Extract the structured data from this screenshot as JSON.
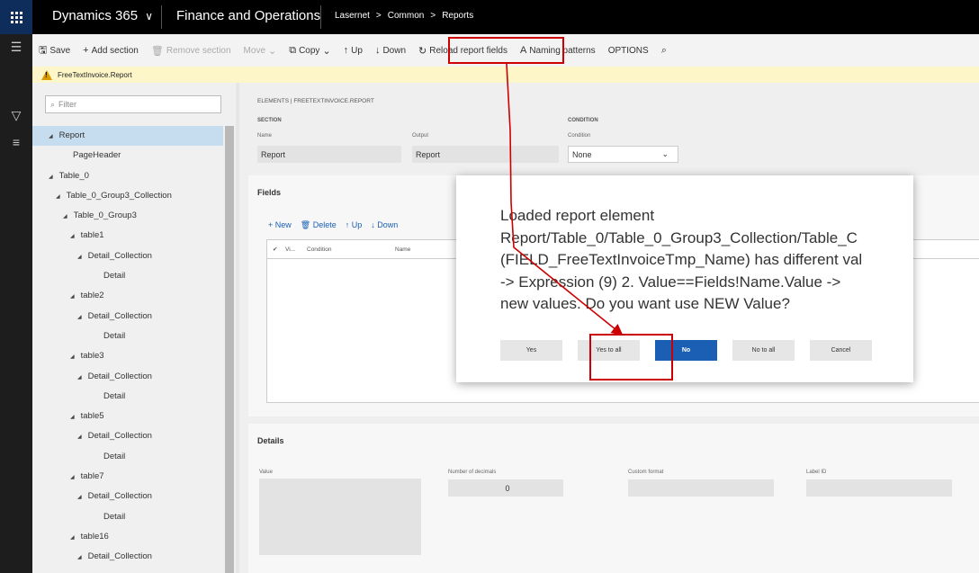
{
  "topnav": {
    "brand": "Dynamics 365",
    "brand_chevron": "∨",
    "module": "Finance and Operations",
    "breadcrumb": [
      "Lasernet",
      "Common",
      "Reports"
    ],
    "breadcrumb_sep": ">"
  },
  "actions": {
    "save": "Save",
    "add_section": "Add section",
    "remove_section": "Remove section",
    "move": "Move",
    "copy": "Copy",
    "up": "Up",
    "down": "Down",
    "reload": "Reload report fields",
    "naming": "Naming patterns",
    "options": "OPTIONS"
  },
  "message_bar": {
    "text": "FreeTextInvoice.Report"
  },
  "tree": {
    "filter_placeholder": "Filter",
    "items": [
      {
        "label": "Report",
        "expander": true,
        "selected": true
      },
      {
        "label": "PageHeader",
        "expander": false
      },
      {
        "label": "Table_0",
        "expander": true
      },
      {
        "label": "Table_0_Group3_Collection",
        "expander": true
      },
      {
        "label": "Table_0_Group3",
        "expander": true
      },
      {
        "label": "table1",
        "expander": true
      },
      {
        "label": "Detail_Collection",
        "expander": true
      },
      {
        "label": "Detail",
        "expander": false
      },
      {
        "label": "table2",
        "expander": true
      },
      {
        "label": "Detail_Collection",
        "expander": true
      },
      {
        "label": "Detail",
        "expander": false
      },
      {
        "label": "table3",
        "expander": true
      },
      {
        "label": "Detail_Collection",
        "expander": true
      },
      {
        "label": "Detail",
        "expander": false
      },
      {
        "label": "table5",
        "expander": true
      },
      {
        "label": "Detail_Collection",
        "expander": true
      },
      {
        "label": "Detail",
        "expander": false
      },
      {
        "label": "table7",
        "expander": true
      },
      {
        "label": "Detail_Collection",
        "expander": true
      },
      {
        "label": "Detail",
        "expander": false
      },
      {
        "label": "table16",
        "expander": true
      },
      {
        "label": "Detail_Collection",
        "expander": true
      }
    ]
  },
  "main": {
    "breadline": "ELEMENTS | FREETEXTINVOICE.REPORT",
    "section_label": "SECTION",
    "condition_label": "CONDITION",
    "name_label": "Name",
    "name_value": "Report",
    "output_label": "Output",
    "output_value": "Report",
    "condition_field_label": "Condition",
    "condition_value": "None",
    "fields_title": "Fields",
    "fields_new": "New",
    "fields_delete": "Delete",
    "fields_up": "Up",
    "fields_down": "Down",
    "grid_columns": [
      "Vi...",
      "Condition",
      "Name"
    ],
    "details_title": "Details",
    "value_label": "Value",
    "decimals_label": "Number of decimals",
    "decimals_value": "0",
    "custom_format_label": "Custom format",
    "label_id_label": "Label ID"
  },
  "dialog": {
    "lines": [
      "Loaded report element",
      "Report/Table_0/Table_0_Group3_Collection/Table_C",
      "(FIELD_FreeTextInvoiceTmp_Name) has different val",
      "-> Expression (9) 2. Value==Fields!Name.Value ->",
      "new values. Do you want use NEW Value?"
    ],
    "buttons": {
      "yes": "Yes",
      "yes_all": "Yes to all",
      "no": "No",
      "no_all": "No to all",
      "cancel": "Cancel"
    }
  },
  "colors": {
    "accent": "#1a5fb4",
    "highlight": "#cc0000",
    "warning_bar": "#fdf6c8",
    "nav": "#000000"
  }
}
